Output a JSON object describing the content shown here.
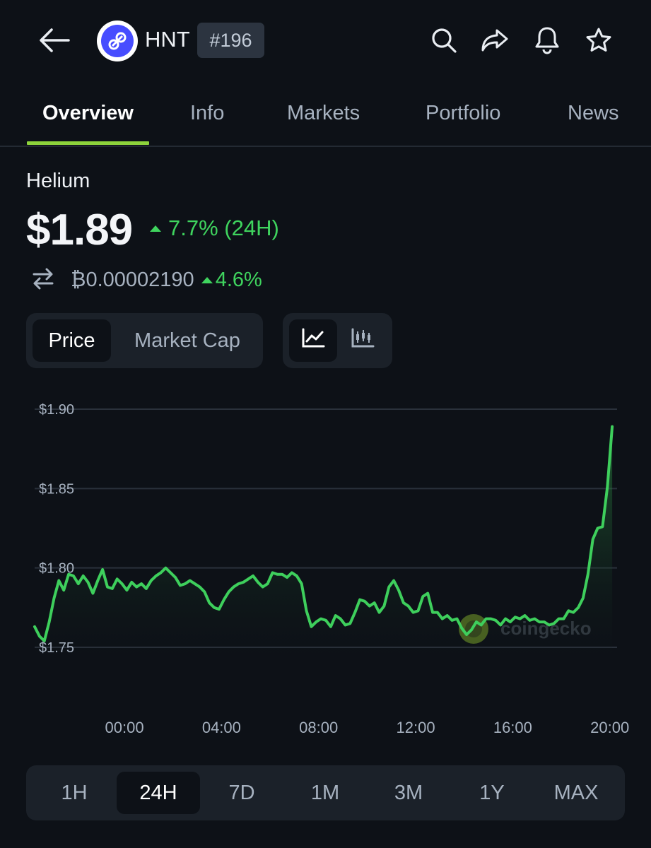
{
  "header": {
    "symbol": "HNT",
    "rank": "#196",
    "icons": [
      "back-arrow-icon",
      "search-icon",
      "share-icon",
      "bell-icon",
      "star-icon"
    ]
  },
  "tabs": [
    {
      "label": "Overview",
      "active": true
    },
    {
      "label": "Info",
      "active": false
    },
    {
      "label": "Markets",
      "active": false
    },
    {
      "label": "Portfolio",
      "active": false
    },
    {
      "label": "News",
      "active": false
    }
  ],
  "coin": {
    "name": "Helium",
    "price": "$1.89",
    "change_24h": "7.7% (24H)",
    "btc_price": "₿0.00002190",
    "btc_change": "4.6%"
  },
  "chart_toggle": {
    "metric_options": [
      "Price",
      "Market Cap"
    ],
    "selected_metric": "Price",
    "chart_types": [
      "line-chart-icon",
      "candlestick-icon"
    ],
    "selected_type": "line-chart-icon"
  },
  "watermark": "coingecko",
  "colors": {
    "background": "#0d1117",
    "accent_green": "#3fd45e",
    "tab_indicator": "#8dd33b",
    "line": "#3ecf5c"
  },
  "chart_data": {
    "type": "area",
    "y_ticks": [
      "$1.90",
      "$1.85",
      "$1.80",
      "$1.75"
    ],
    "ylim": [
      1.75,
      1.9
    ],
    "x_ticks": [
      "00:00",
      "04:00",
      "08:00",
      "12:00",
      "16:00",
      "20:00"
    ],
    "x_tick_hours": [
      0,
      4,
      8,
      12,
      16,
      20
    ],
    "x_range_hours": [
      -3.7,
      20.3
    ],
    "series": [
      {
        "hours": [
          -3.7,
          -3.5,
          -3.3,
          -3.1,
          -2.9,
          -2.7,
          -2.5,
          -2.3,
          -2.1,
          -1.9,
          -1.7,
          -1.5,
          -1.3,
          -1.1,
          -0.9,
          -0.7,
          -0.5,
          -0.3,
          -0.1,
          0.1,
          0.3,
          0.5,
          0.7,
          0.9,
          1.1,
          1.3,
          1.5,
          1.7,
          1.9,
          2.1,
          2.3,
          2.5,
          2.7,
          2.9,
          3.1,
          3.3,
          3.5,
          3.7,
          3.9,
          4.1,
          4.3,
          4.5,
          4.7,
          4.9,
          5.1,
          5.3,
          5.5,
          5.7,
          5.9,
          6.1,
          6.3,
          6.5,
          6.7,
          6.9,
          7.1,
          7.3,
          7.5,
          7.7,
          7.9,
          8.1,
          8.3,
          8.5,
          8.7,
          8.9,
          9.1,
          9.3,
          9.5,
          9.7,
          9.9,
          10.1,
          10.3,
          10.5,
          10.7,
          10.9,
          11.1,
          11.3,
          11.5,
          11.7,
          11.9,
          12.1,
          12.3,
          12.5,
          12.7,
          12.9,
          13.1,
          13.3,
          13.5,
          13.7,
          13.9,
          14.1,
          14.3,
          14.5,
          14.7,
          14.9,
          15.1,
          15.3,
          15.5,
          15.7,
          15.9,
          16.1,
          16.3,
          16.5,
          16.7,
          16.9,
          17.1,
          17.3,
          17.5,
          17.7,
          17.9,
          18.1,
          18.3,
          18.5,
          18.7,
          18.9,
          19.1,
          19.3,
          19.5,
          19.7,
          19.9,
          20.1
        ],
        "values": [
          1.763,
          1.757,
          1.754,
          1.766,
          1.781,
          1.792,
          1.786,
          1.796,
          1.795,
          1.79,
          1.795,
          1.791,
          1.784,
          1.792,
          1.799,
          1.788,
          1.787,
          1.793,
          1.79,
          1.786,
          1.791,
          1.788,
          1.79,
          1.787,
          1.792,
          1.795,
          1.797,
          1.8,
          1.797,
          1.794,
          1.789,
          1.79,
          1.792,
          1.79,
          1.788,
          1.785,
          1.778,
          1.775,
          1.774,
          1.78,
          1.785,
          1.788,
          1.79,
          1.791,
          1.793,
          1.795,
          1.791,
          1.788,
          1.79,
          1.797,
          1.796,
          1.796,
          1.794,
          1.797,
          1.795,
          1.79,
          1.773,
          1.763,
          1.766,
          1.768,
          1.767,
          1.763,
          1.77,
          1.768,
          1.764,
          1.765,
          1.772,
          1.78,
          1.779,
          1.776,
          1.778,
          1.772,
          1.776,
          1.788,
          1.792,
          1.786,
          1.778,
          1.776,
          1.772,
          1.773,
          1.782,
          1.784,
          1.772,
          1.772,
          1.768,
          1.77,
          1.767,
          1.768,
          1.762,
          1.758,
          1.761,
          1.766,
          1.764,
          1.768,
          1.768,
          1.767,
          1.764,
          1.768,
          1.766,
          1.769,
          1.768,
          1.77,
          1.767,
          1.768,
          1.766,
          1.766,
          1.764,
          1.765,
          1.768,
          1.768,
          1.773,
          1.772,
          1.775,
          1.781,
          1.796,
          1.818,
          1.825,
          1.826,
          1.851,
          1.889
        ]
      }
    ],
    "grid": true,
    "xlabel": "",
    "ylabel": ""
  },
  "time_ranges": [
    "1H",
    "24H",
    "7D",
    "1M",
    "3M",
    "1Y",
    "MAX"
  ],
  "selected_range": "24H"
}
